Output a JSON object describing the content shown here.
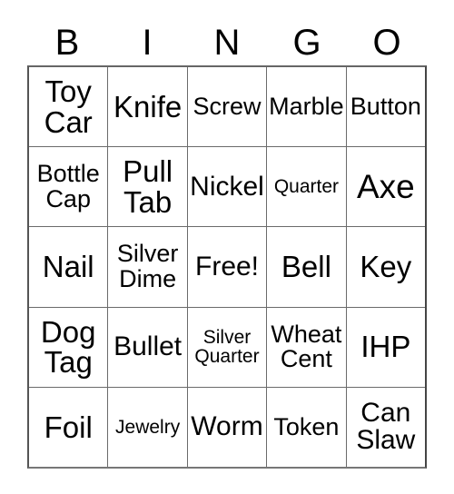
{
  "card": {
    "headers": [
      "B",
      "I",
      "N",
      "G",
      "O"
    ],
    "rows": [
      [
        {
          "text": "Toy\nCar",
          "size": "fs-lg"
        },
        {
          "text": "Knife",
          "size": "fs-lg"
        },
        {
          "text": "Screw",
          "size": "fs-sm"
        },
        {
          "text": "Marble",
          "size": "fs-sm"
        },
        {
          "text": "Button",
          "size": "fs-sm"
        }
      ],
      [
        {
          "text": "Bottle\nCap",
          "size": "fs-sm"
        },
        {
          "text": "Pull\nTab",
          "size": "fs-lg"
        },
        {
          "text": "Nickel",
          "size": "fs-md"
        },
        {
          "text": "Quarter",
          "size": "fs-xxs"
        },
        {
          "text": "Axe",
          "size": "fs-xl"
        }
      ],
      [
        {
          "text": "Nail",
          "size": "fs-lg"
        },
        {
          "text": "Silver\nDime",
          "size": "fs-sm"
        },
        {
          "text": "Free!",
          "size": "fs-md"
        },
        {
          "text": "Bell",
          "size": "fs-lg"
        },
        {
          "text": "Key",
          "size": "fs-lg"
        }
      ],
      [
        {
          "text": "Dog\nTag",
          "size": "fs-lg"
        },
        {
          "text": "Bullet",
          "size": "fs-md"
        },
        {
          "text": "Silver\nQuarter",
          "size": "fs-xxs"
        },
        {
          "text": "Wheat\nCent",
          "size": "fs-sm"
        },
        {
          "text": "IHP",
          "size": "fs-lg"
        }
      ],
      [
        {
          "text": "Foil",
          "size": "fs-lg"
        },
        {
          "text": "Jewelry",
          "size": "fs-xxs"
        },
        {
          "text": "Worm",
          "size": "fs-md"
        },
        {
          "text": "Token",
          "size": "fs-sm"
        },
        {
          "text": "Can\nSlaw",
          "size": "fs-md"
        }
      ]
    ]
  },
  "colors": {
    "background": "#ffffff",
    "text": "#000000",
    "grid_line": "#6b6b6b",
    "outer_border": "#555555"
  }
}
